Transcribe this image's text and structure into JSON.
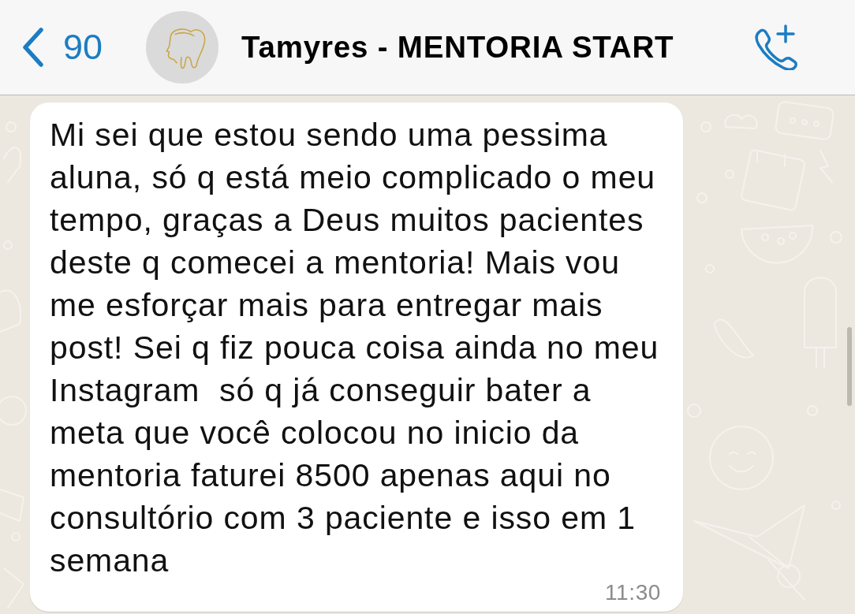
{
  "header": {
    "back_count": "90",
    "contact_name": "Tamyres - MENTORIA START"
  },
  "messages": [
    {
      "kind": "incoming",
      "lines": [
        "Mi sei que estou sendo uma pessima",
        "aluna, só q está meio complicado o meu",
        "tempo, graças a Deus muitos pacientes",
        "deste q comecei a mentoria! Mais vou",
        "me esforçar mais para entregar mais",
        "post! Sei q fiz pouca coisa ainda no meu",
        "Instagram  só q já conseguir bater a",
        "meta que você colocou no inicio da",
        "mentoria faturei 8500 apenas aqui no",
        "consultório com 3 paciente e isso em 1",
        "semana"
      ],
      "time": "11:30"
    }
  ]
}
